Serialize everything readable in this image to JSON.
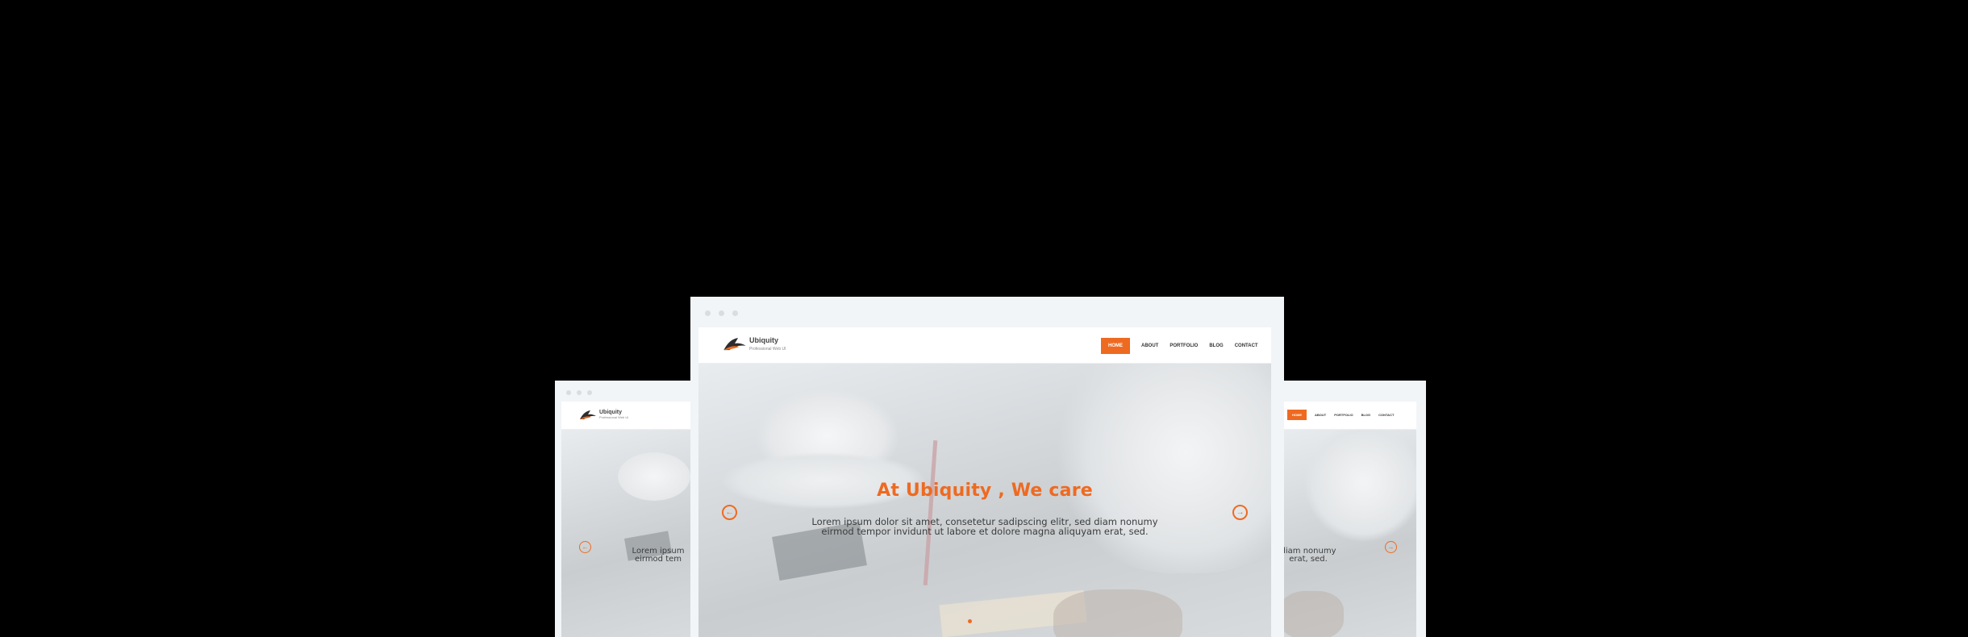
{
  "site": {
    "brand_name": "Ubiquity",
    "brand_tagline": "Professional Web UI",
    "nav": [
      "Home",
      "About",
      "Portfolio",
      "Blog",
      "Contact"
    ],
    "active_nav": "Home"
  },
  "hero": {
    "headline": "At Ubiquity , We care",
    "lead_line1": "Lorem ipsum dolor sit amet, consetetur sadipscing elitr, sed diam nonumy",
    "lead_line2": "eirmod tempor invidunt ut labore et dolore magna aliquyam erat, sed."
  },
  "left_window": {
    "lead_line1": "Lorem ipsum",
    "lead_line2": "eirmod tem"
  },
  "right_window": {
    "lead_line1": "diam nonumy",
    "lead_line2": "erat, sed."
  },
  "carousel": {
    "prev_icon": "arrow-left-circle-icon",
    "next_icon": "arrow-right-circle-icon",
    "slides_count": 1
  },
  "colors": {
    "accent": "#ee6a21",
    "background": "#000000",
    "window_chrome": "#f2f5f7"
  }
}
